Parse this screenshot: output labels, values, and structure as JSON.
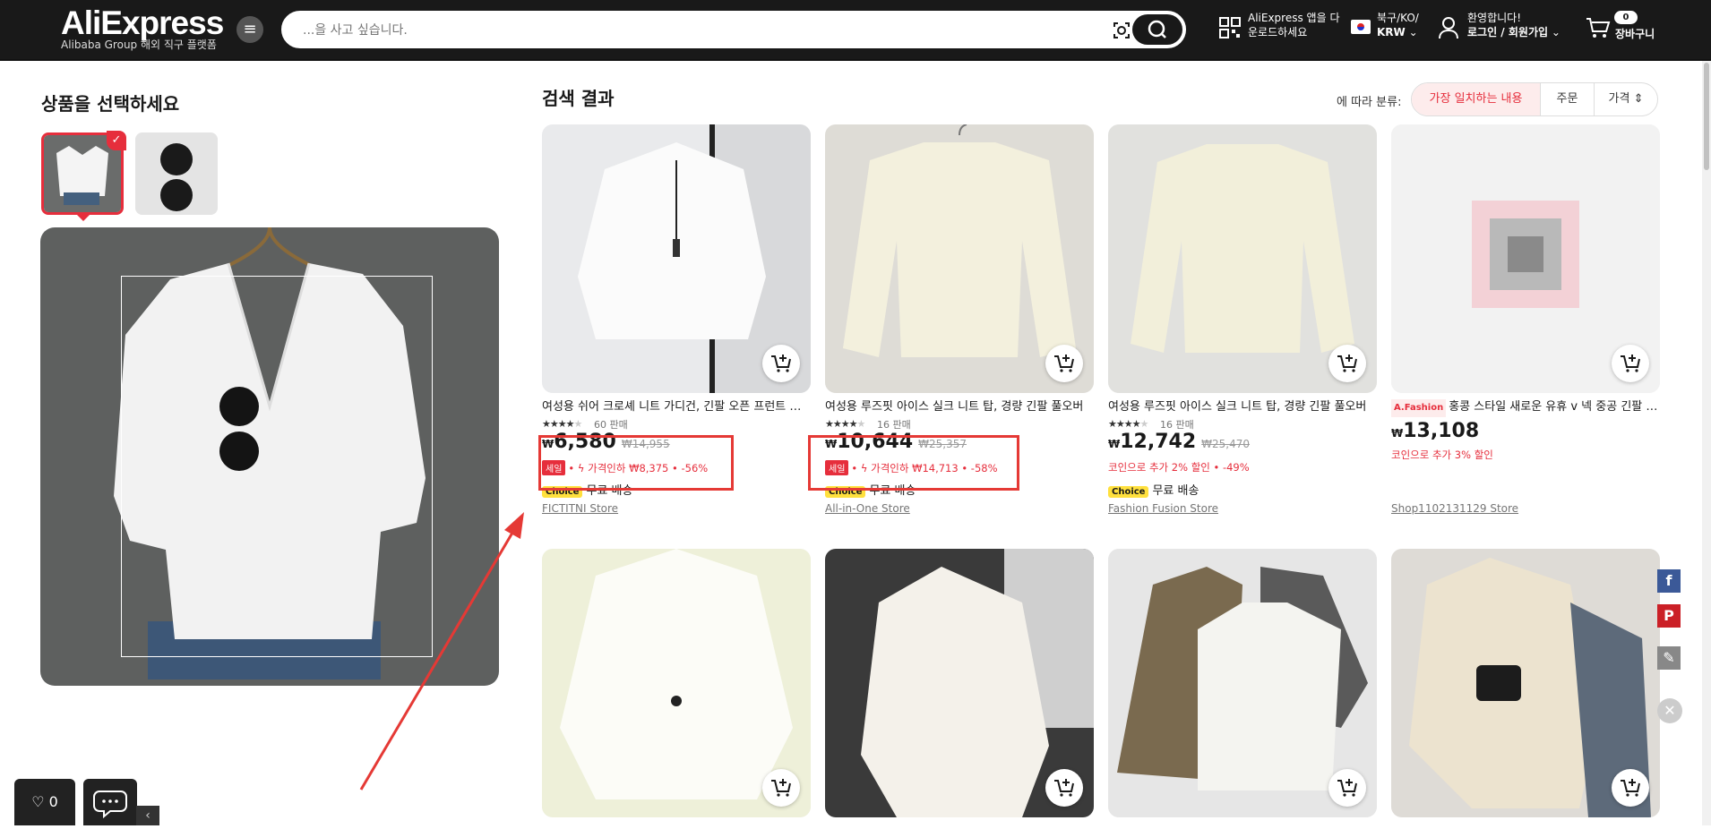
{
  "header": {
    "logo": "AliExpress",
    "logo_sub": "Alibaba Group 해외 직구 플랫폼",
    "search_placeholder": "...을 사고 싶습니다.",
    "app_line1": "AliExpress 앱을 다",
    "app_line2": "운로드하세요",
    "region_line1": "북구/KO/",
    "region_line2": "KRW",
    "user_line1": "환영합니다!",
    "user_line2": "로그인 / 회원가입",
    "cart_count": "0",
    "cart_label": "장바구니"
  },
  "left": {
    "title": "상품을 선택하세요"
  },
  "results": {
    "title": "검색 결과",
    "sort_label": "에 따라 분류:",
    "sort_options": [
      "가장 일치하는 내용",
      "주문",
      "가격"
    ]
  },
  "products": [
    {
      "name": "여성용 쉬어 크로셰 니트 가디건, 긴팔 오픈 프런트 가디건",
      "rating": 4.5,
      "sold": "60 판매",
      "currency": "₩",
      "price": "6,580",
      "old_price": "₩14,955",
      "sale": "세일",
      "promo": "가격인하 ₩8,375 • -56%",
      "choice": "Choice",
      "ship": "무료 배송",
      "store": "FICTITNI Store"
    },
    {
      "name": "여성용 루즈핏 아이스 실크 니트 탑, 경량 긴팔 풀오버",
      "rating": 4,
      "sold": "16 판매",
      "currency": "₩",
      "price": "10,644",
      "old_price": "₩25,357",
      "sale": "세일",
      "promo": "가격인하 ₩14,713 • -58%",
      "choice": "Choice",
      "ship": "무료 배송",
      "store": "All-in-One Store"
    },
    {
      "name": "여성용 루즈핏 아이스 실크 니트 탑, 경량 긴팔 풀오버",
      "rating": 4,
      "sold": "16 판매",
      "currency": "₩",
      "price": "12,742",
      "old_price": "₩25,470",
      "promo": "코인으로 추가 2% 할인 • -49%",
      "choice": "Choice",
      "ship": "무료 배송",
      "store": "Fashion Fusion Store"
    },
    {
      "name": "홍콩 스타일 새로운 유휴 v 넥 중공 긴팔 니트",
      "badge": "A.Fashion",
      "currency": "₩",
      "price": "13,108",
      "promo": "코인으로 추가 3% 할인",
      "store": "Shop1102131129 Store"
    }
  ],
  "wishlist_count": "0",
  "colors": {
    "accent": "#e62e3c",
    "header_bg": "#191919",
    "annotation": "#e53935"
  }
}
